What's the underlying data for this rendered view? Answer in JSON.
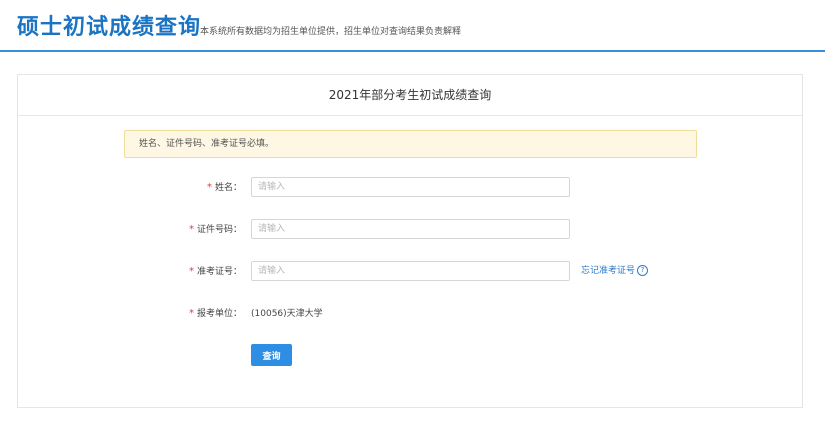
{
  "header": {
    "title": "硕士初试成绩查询",
    "subtitle": "本系统所有数据均为招生单位提供，招生单位对查询结果负责解释"
  },
  "panel": {
    "title": "2021年部分考生初试成绩查询"
  },
  "notice": {
    "text": "姓名、证件号码、准考证号必填。"
  },
  "form": {
    "required_mark": "*",
    "name": {
      "label": "姓名：",
      "placeholder": "请输入",
      "value": ""
    },
    "id_number": {
      "label": "证件号码：",
      "placeholder": "请输入",
      "value": ""
    },
    "exam_number": {
      "label": "准考证号：",
      "placeholder": "请输入",
      "value": "",
      "forgot_link": "忘记准考证号",
      "help_icon_char": "?"
    },
    "school": {
      "label": "报考单位：",
      "value": "(10056)天津大学"
    },
    "submit_label": "查询"
  },
  "colors": {
    "brand": "#1b73c4",
    "header_rule": "#3a8fd6",
    "button": "#2e8ee4",
    "required": "#e43b3b",
    "notice_bg": "#fdf7e3",
    "notice_border": "#f2dc9a",
    "link": "#2b7bd1"
  },
  "icons": {
    "help": "question-circle-icon"
  }
}
